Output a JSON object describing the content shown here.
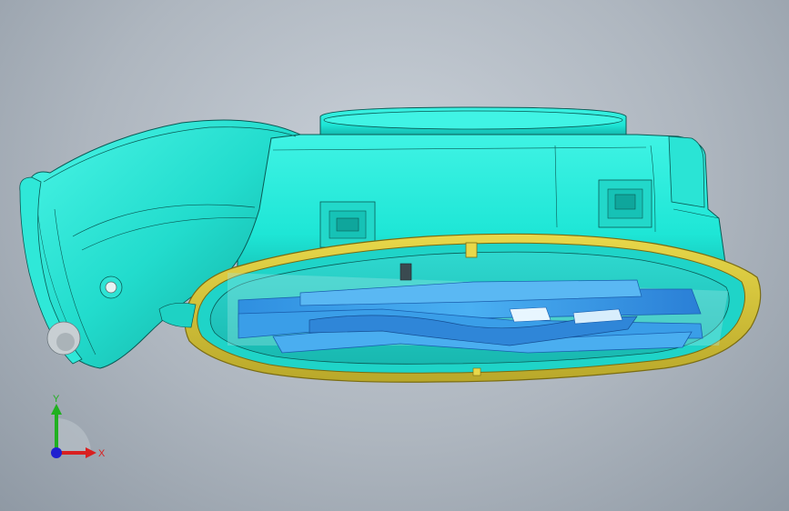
{
  "viewport": {
    "background_top": "#c9d0d8",
    "background_bottom": "#8f99a4"
  },
  "model": {
    "body_color": "#1ee6d6",
    "body_shade": "#14b8ad",
    "edge_color": "#0a5a55",
    "blade_color": "#3aa0ea",
    "blade_dark": "#1f6fc4",
    "rim_color": "#d9c63a",
    "rim_dark": "#8a7a14"
  },
  "triad": {
    "x_label": "X",
    "y_label": "Y",
    "x_color": "#d92020",
    "y_color": "#20b020",
    "z_color": "#2020d0"
  }
}
